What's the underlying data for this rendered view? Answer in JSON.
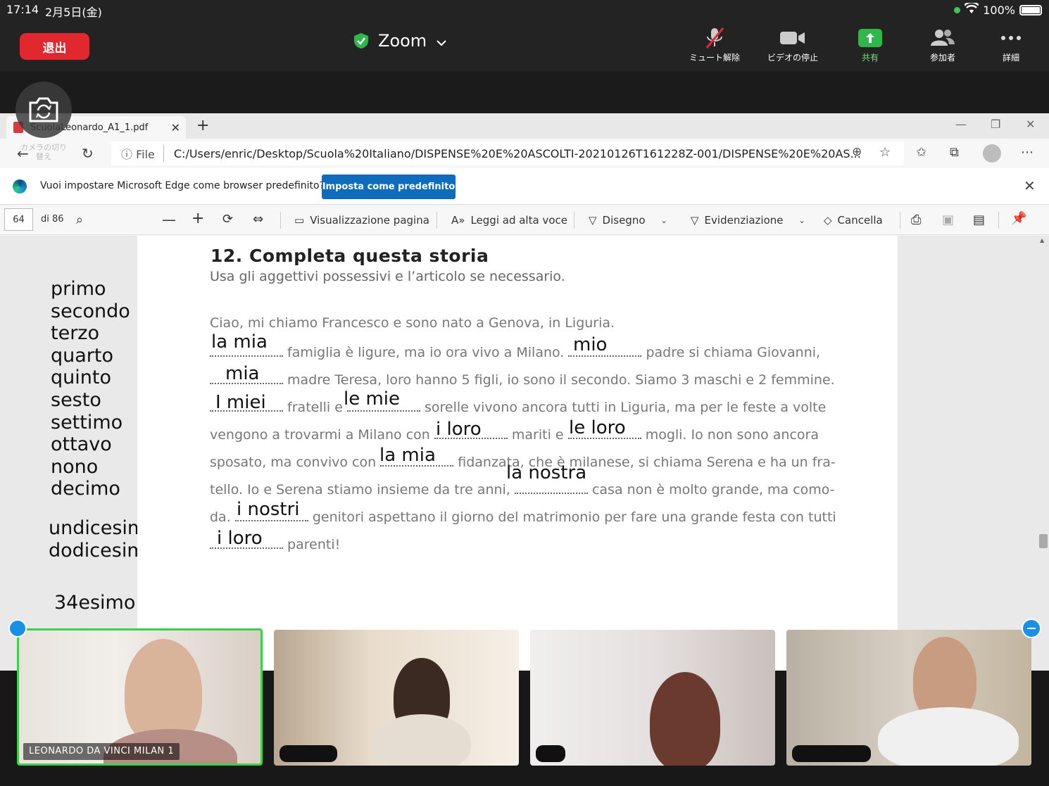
{
  "status": {
    "time": "17:14",
    "date": "2月5日(金)",
    "battery": "100%"
  },
  "zoom": {
    "leave_label": "退出",
    "title": "Zoom",
    "tools": [
      {
        "label": "ミュート解除",
        "icon": "mic-muted-icon"
      },
      {
        "label": "ビデオの停止",
        "icon": "video-camera-icon"
      },
      {
        "label": "共有",
        "icon": "share-arrow-icon"
      },
      {
        "label": "参加者",
        "icon": "participants-icon"
      },
      {
        "label": "詳細",
        "icon": "more-dots-icon"
      }
    ],
    "camera_switch_label": "カメラの切り替え"
  },
  "browser": {
    "tab_title": "ScuolaLeonardo_A1_1.pdf",
    "address_prefix": "File",
    "url": "C:/Users/enric/Desktop/Scuola%20Italiano/DISPENSE%20E%20ASCOLTI-20210126T161228Z-001/DISPENSE%20E%20AS...",
    "info_text": "Vuoi impostare Microsoft Edge come browser predefinito?",
    "set_default_label": "Imposta come predefinito"
  },
  "pdf_toolbar": {
    "page": "64",
    "of_pages": "di 86",
    "view_page": "Visualizzazione pagina",
    "read_aloud": "Leggi ad alta voce",
    "draw": "Disegno",
    "highlight": "Evidenziazione",
    "erase": "Cancella"
  },
  "exercise": {
    "title": "12. Completa questa storia",
    "subtitle": "Usa gli aggettivi possessivi e l’articolo se necessario.",
    "lines": [
      "Ciao, mi chiamo Francesco e sono nato a Genova, in Liguria.",
      "famiglia è ligure, ma io ora vivo a Milano.",
      "padre si chiama Giovanni,",
      "madre Teresa, loro hanno 5 figli, io sono il secondo. Siamo 3 maschi e 2 femmine.",
      "fratelli e",
      "sorelle vivono ancora tutti in Liguria, ma per le feste a volte",
      "vengono a trovarmi a Milano con",
      "mariti e",
      "mogli. Io non sono ancora",
      "sposato, ma convivo con",
      "fidanzata, che è milanese, si chiama Serena e ha un fra-",
      "tello. Io e Serena stiamo insieme da tre anni,",
      "casa non è molto grande, ma como-",
      "da.",
      "genitori aspettano il giorno del matrimonio per fare una grande festa con tutti",
      "parenti!"
    ],
    "answers": [
      "la mia",
      "mio",
      "mia",
      "I miei",
      "le mie",
      "i loro",
      "le loro",
      "la mia",
      "la nostra",
      "i nostri",
      "i loro"
    ]
  },
  "side_notes": {
    "ordinals": [
      "primo",
      "secondo",
      "terzo",
      "quarto",
      "quinto",
      "sesto",
      "settimo",
      "ottavo",
      "nono",
      "decimo"
    ],
    "more": [
      "undicesimo",
      "dodicesimo…"
    ],
    "last": "34esimo"
  },
  "participants": [
    {
      "name": "LEONARDO DA VINCI MILAN 1",
      "active": true
    }
  ]
}
